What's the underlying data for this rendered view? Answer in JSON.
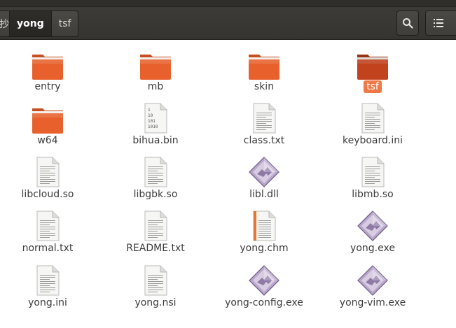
{
  "header": {
    "breadcrumbs": [
      {
        "label": "抄",
        "current": false
      },
      {
        "label": "yong",
        "current": true
      },
      {
        "label": "tsf",
        "current": false
      }
    ],
    "search_icon": "search-icon",
    "view_icon": "list-view-icon"
  },
  "files": [
    {
      "name": "entry",
      "type": "folder"
    },
    {
      "name": "mb",
      "type": "folder"
    },
    {
      "name": "skin",
      "type": "folder"
    },
    {
      "name": "tsf",
      "type": "folder",
      "selected": true
    },
    {
      "name": "w64",
      "type": "folder"
    },
    {
      "name": "bihua.bin",
      "type": "binary"
    },
    {
      "name": "class.txt",
      "type": "text"
    },
    {
      "name": "keyboard.ini",
      "type": "text"
    },
    {
      "name": "libcloud.so",
      "type": "text"
    },
    {
      "name": "libgbk.so",
      "type": "text"
    },
    {
      "name": "libl.dll",
      "type": "exe"
    },
    {
      "name": "libmb.so",
      "type": "text"
    },
    {
      "name": "normal.txt",
      "type": "text"
    },
    {
      "name": "README.txt",
      "type": "text"
    },
    {
      "name": "yong.chm",
      "type": "chm"
    },
    {
      "name": "yong.exe",
      "type": "exe"
    },
    {
      "name": "yong.ini",
      "type": "text"
    },
    {
      "name": "yong.nsi",
      "type": "text"
    },
    {
      "name": "yong-config.exe",
      "type": "exe"
    },
    {
      "name": "yong-vim.exe",
      "type": "exe"
    }
  ],
  "colors": {
    "folder": "#e8612c",
    "folder_selected": "#d2481f",
    "selection": "#f07746",
    "header": "#3c3b37"
  }
}
